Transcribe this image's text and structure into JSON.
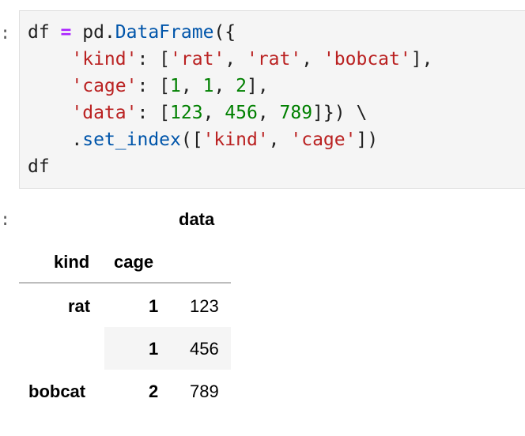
{
  "prompts": {
    "input": ":",
    "output": ":"
  },
  "code_lines": [
    {
      "parts": [
        {
          "t": "df ",
          "c": ""
        },
        {
          "t": "=",
          "c": "kw-op"
        },
        {
          "t": " pd.",
          "c": ""
        },
        {
          "t": "DataFrame",
          "c": "fn"
        },
        {
          "t": "({",
          "c": ""
        }
      ]
    },
    {
      "parts": [
        {
          "t": "    ",
          "c": ""
        },
        {
          "t": "'kind'",
          "c": "str"
        },
        {
          "t": ": [",
          "c": ""
        },
        {
          "t": "'rat'",
          "c": "str"
        },
        {
          "t": ", ",
          "c": ""
        },
        {
          "t": "'rat'",
          "c": "str"
        },
        {
          "t": ", ",
          "c": ""
        },
        {
          "t": "'bobcat'",
          "c": "str"
        },
        {
          "t": "],",
          "c": ""
        }
      ]
    },
    {
      "parts": [
        {
          "t": "    ",
          "c": ""
        },
        {
          "t": "'cage'",
          "c": "str"
        },
        {
          "t": ": [",
          "c": ""
        },
        {
          "t": "1",
          "c": "num"
        },
        {
          "t": ", ",
          "c": ""
        },
        {
          "t": "1",
          "c": "num"
        },
        {
          "t": ", ",
          "c": ""
        },
        {
          "t": "2",
          "c": "num"
        },
        {
          "t": "],",
          "c": ""
        }
      ]
    },
    {
      "parts": [
        {
          "t": "    ",
          "c": ""
        },
        {
          "t": "'data'",
          "c": "str"
        },
        {
          "t": ": [",
          "c": ""
        },
        {
          "t": "123",
          "c": "num"
        },
        {
          "t": ", ",
          "c": ""
        },
        {
          "t": "456",
          "c": "num"
        },
        {
          "t": ", ",
          "c": ""
        },
        {
          "t": "789",
          "c": "num"
        },
        {
          "t": "]}) \\",
          "c": ""
        }
      ]
    },
    {
      "parts": [
        {
          "t": "    .",
          "c": ""
        },
        {
          "t": "set_index",
          "c": "fn"
        },
        {
          "t": "([",
          "c": ""
        },
        {
          "t": "'kind'",
          "c": "str"
        },
        {
          "t": ", ",
          "c": ""
        },
        {
          "t": "'cage'",
          "c": "str"
        },
        {
          "t": "])",
          "c": ""
        }
      ]
    },
    {
      "parts": [
        {
          "t": "df",
          "c": ""
        }
      ]
    }
  ],
  "table": {
    "column_header": "data",
    "index_names": [
      "kind",
      "cage"
    ],
    "rows": [
      {
        "kind": "rat",
        "cage": "1",
        "data": "123"
      },
      {
        "kind": "",
        "cage": "1",
        "data": "456"
      },
      {
        "kind": "bobcat",
        "cage": "2",
        "data": "789"
      }
    ]
  }
}
